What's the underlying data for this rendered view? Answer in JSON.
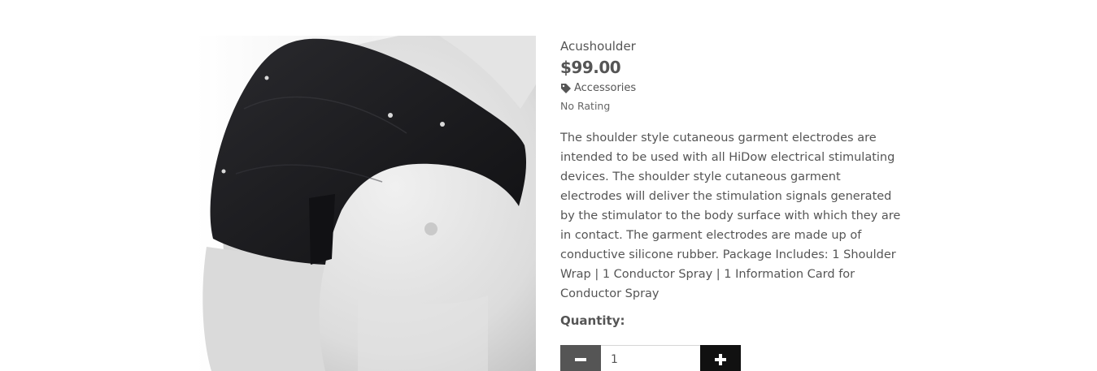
{
  "product": {
    "name": "Acushoulder",
    "price": "$99.00",
    "category": "Accessories",
    "rating": "No Rating",
    "description": "The shoulder style cutaneous garment electrodes are intended to be used with all HiDow electrical stimulating devices. The shoulder style cutaneous garment electrodes will deliver the stimulation signals generated by the stimulator to the body surface with which they are in contact. The garment electrodes are made up of conductive silicone rubber. Package Includes: 1 Shoulder Wrap | 1 Conductor Spray | 1 Information Card for Conductor Spray"
  },
  "quantity": {
    "label": "Quantity:",
    "value": "1"
  },
  "icons": {
    "category": "tag-icon",
    "decrease": "minus-icon",
    "increase": "plus-icon"
  },
  "colors": {
    "text": "#555555",
    "minus_button": "#555555",
    "plus_button": "#111111"
  }
}
